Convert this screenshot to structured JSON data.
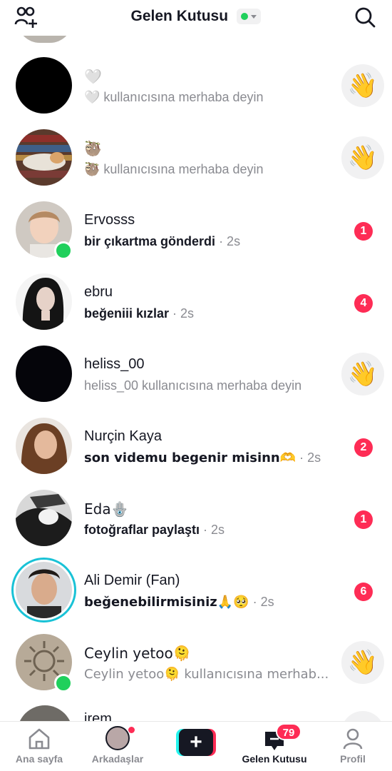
{
  "header": {
    "title": "Gelen Kutusu",
    "left_icon": "add-friend-icon",
    "right_icon": "search-icon",
    "status_color": "#20d05c"
  },
  "conversations": [
    {
      "name": "🤍",
      "subtitle": "🤍 kullanıcısına merhaba deyin",
      "style": "muted",
      "time": "",
      "action": "wave",
      "emoji": "👋"
    },
    {
      "name": "🦥",
      "subtitle": "🦥 kullanıcısına merhaba deyin",
      "style": "muted",
      "time": "",
      "action": "wave",
      "emoji": "👋"
    },
    {
      "name": "Ervosss",
      "subtitle": "bir çıkartma gönderdi",
      "style": "bold",
      "time": "· 2s",
      "action": "badge",
      "badge": "1",
      "online": true
    },
    {
      "name": "ebru",
      "subtitle": "beğeniii kızlar",
      "style": "bold",
      "time": " · 2s",
      "action": "badge",
      "badge": "4"
    },
    {
      "name": "heliss_00",
      "subtitle": "heliss_00 kullanıcısına merhaba deyin",
      "style": "muted",
      "time": "",
      "action": "wave",
      "emoji": "👋"
    },
    {
      "name": "Nurçin Kaya",
      "subtitle": "son videmu begenir misinn🫶",
      "style": "bold",
      "time": " · 2s",
      "action": "badge",
      "badge": "2"
    },
    {
      "name": "Eda🪬",
      "subtitle": "fotoğraflar paylaştı",
      "style": "bold",
      "time": " · 2s",
      "action": "badge",
      "badge": "1"
    },
    {
      "name": "Ali Demir (Fan)",
      "subtitle": "beğenebilirmisiniz🙏🥺",
      "style": "bold",
      "time": " · 2s",
      "action": "badge",
      "badge": "6",
      "ring": true
    },
    {
      "name": "Ceylin yetoo🫠",
      "subtitle": "Ceylin yetoo🫠 kullanıcısına merhab...",
      "style": "muted",
      "time": "",
      "action": "wave",
      "emoji": "👋",
      "online": true
    }
  ],
  "peek_bottom": {
    "name": "irem"
  },
  "bottom_nav": {
    "home": "Ana sayfa",
    "friends": "Arkadaşlar",
    "inbox": "Gelen Kutusu",
    "inbox_badge": "79",
    "profile": "Profil"
  },
  "colors": {
    "accent_red": "#fe2c55",
    "accent_cyan": "#25f4ee",
    "online_green": "#20d05c",
    "muted_text": "#8a8b91"
  }
}
